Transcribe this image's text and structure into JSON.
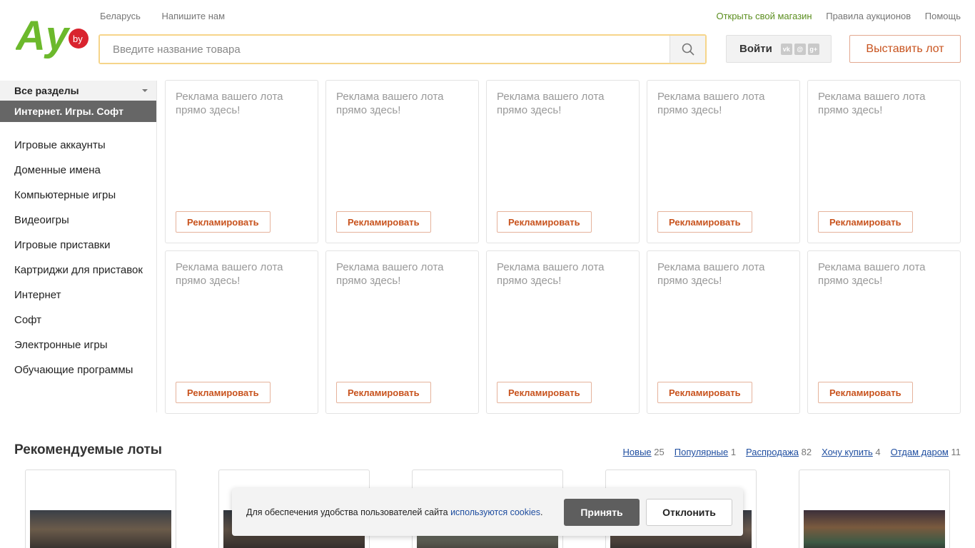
{
  "brand": {
    "logo_main": "Ay",
    "logo_badge": "by",
    "green": "#6cb92c",
    "red": "#d9232e"
  },
  "top_links_left": [
    "Беларусь",
    "Напишите нам"
  ],
  "top_links_right": [
    "Открыть свой магазин",
    "Правила аукционов",
    "Помощь"
  ],
  "search": {
    "placeholder": "Введите название товара",
    "icon": "search-icon"
  },
  "login": {
    "label": "Войти",
    "social": [
      "vk",
      "mail",
      "g+"
    ]
  },
  "post_lot": "Выставить лот",
  "sidebar": {
    "all_sections": "Все разделы",
    "current": "Интернет. Игры. Софт",
    "items": [
      "Игровые аккаунты",
      "Доменные имена",
      "Компьютерные игры",
      "Видеоигры",
      "Игровые приставки",
      "Картриджи для приставок",
      "Интернет",
      "Софт",
      "Электронные игры",
      "Обучающие программы"
    ]
  },
  "ads": {
    "text": "Реклама вашего лота прямо здесь!",
    "button": "Рекламировать",
    "count": 10
  },
  "recommended": {
    "title": "Рекомендуемые лоты",
    "tabs": [
      {
        "label": "Новые",
        "count": "25"
      },
      {
        "label": "Популярные",
        "count": "1"
      },
      {
        "label": "Распродажа",
        "count": "82"
      },
      {
        "label": "Хочу купить",
        "count": "4"
      },
      {
        "label": "Отдам даром",
        "count": "11"
      }
    ]
  },
  "cookie": {
    "text": "Для обеспечения удобства пользователей сайта ",
    "link": "используются cookies",
    "after": ".",
    "accept": "Принять",
    "decline": "Отклонить"
  }
}
